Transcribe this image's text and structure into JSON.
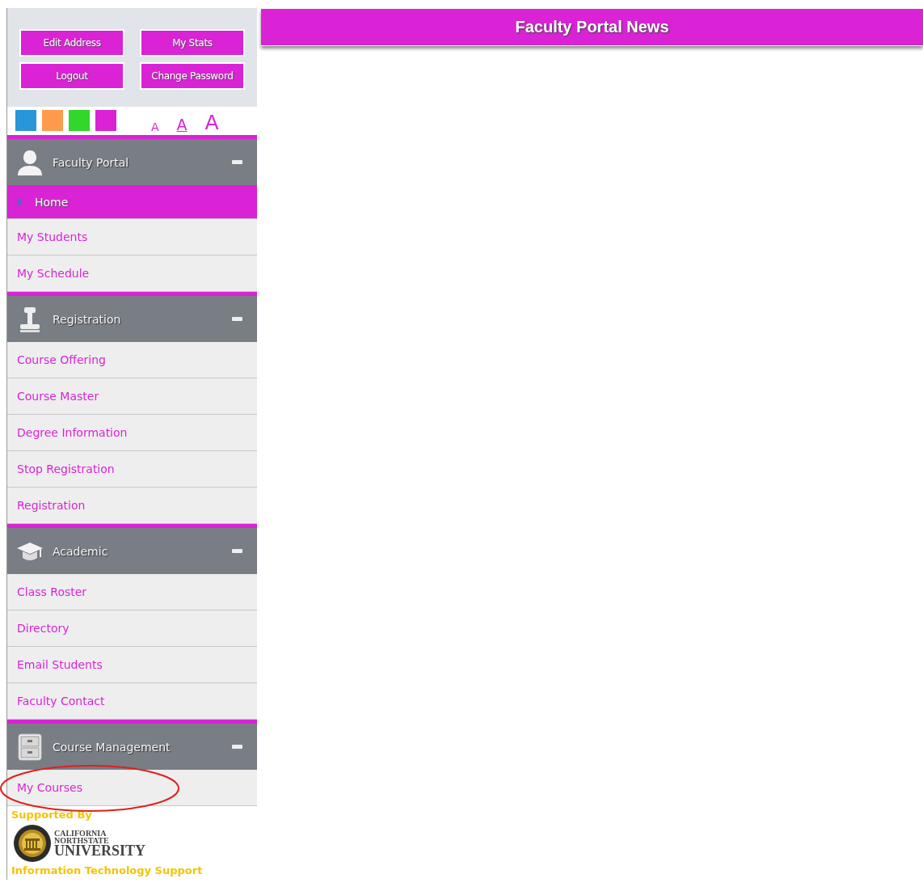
{
  "account_buttons": [
    "Edit Address",
    "My Stats",
    "Logout",
    "Change Password"
  ],
  "themes": [
    {
      "color": "#2a96d8"
    },
    {
      "color": "#fd9a4c"
    },
    {
      "color": "#33d62a"
    },
    {
      "color": "#d923d5"
    }
  ],
  "font_sizes": [
    {
      "label": "A",
      "kind": "small",
      "selected": false
    },
    {
      "label": "A",
      "kind": "medium",
      "selected": true
    },
    {
      "label": "A",
      "kind": "large",
      "selected": false
    }
  ],
  "sections": [
    {
      "title": "Faculty Portal",
      "kind": "person",
      "expanded": true,
      "items": [
        {
          "label": "Home",
          "selected": true
        },
        {
          "label": "My Students",
          "selected": false
        },
        {
          "label": "My Schedule",
          "selected": false
        }
      ]
    },
    {
      "title": "Registration",
      "kind": "stamp",
      "expanded": true,
      "items": [
        {
          "label": "Course Offering",
          "selected": false
        },
        {
          "label": "Course Master",
          "selected": false
        },
        {
          "label": "Degree Information",
          "selected": false
        },
        {
          "label": "Stop Registration",
          "selected": false
        },
        {
          "label": "Registration",
          "selected": false
        }
      ]
    },
    {
      "title": "Academic",
      "kind": "cap",
      "expanded": true,
      "items": [
        {
          "label": "Class Roster",
          "selected": false
        },
        {
          "label": "Directory",
          "selected": false
        },
        {
          "label": "Email Students",
          "selected": false
        },
        {
          "label": "Faculty Contact",
          "selected": false
        }
      ]
    },
    {
      "title": "Course Management",
      "kind": "cabinet",
      "expanded": true,
      "items": [
        {
          "label": "My Courses",
          "selected": false,
          "circled": true
        }
      ]
    }
  ],
  "footer": {
    "supported_by": "Supported By",
    "logo_lines": [
      "CALIFORNIA",
      "NORTHSTATE",
      "UNIVERSITY"
    ],
    "department": "Information Technology Support"
  },
  "news": {
    "title": "Faculty Portal News"
  }
}
